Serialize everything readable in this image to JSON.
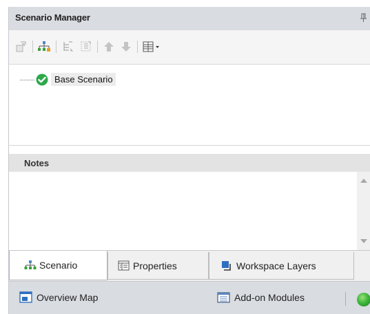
{
  "panel": {
    "title": "Scenario Manager",
    "pin_icon": "pin-icon"
  },
  "toolbar": {
    "buttons": [
      {
        "name": "new-scenario-icon",
        "enabled": false
      },
      {
        "name": "child-scenario-icon",
        "enabled": true
      },
      {
        "name": "expand-all-icon",
        "enabled": false
      },
      {
        "name": "collapse-all-icon",
        "enabled": false
      },
      {
        "name": "move-up-icon",
        "enabled": false
      },
      {
        "name": "move-down-icon",
        "enabled": false
      },
      {
        "name": "view-options-icon",
        "enabled": true
      }
    ]
  },
  "tree": {
    "items": [
      {
        "label": "Base Scenario",
        "status_icon": "check-circle-icon",
        "status_color": "#2ea84a",
        "selected": true
      }
    ]
  },
  "notes": {
    "title": "Notes",
    "value": ""
  },
  "tabs": [
    {
      "label": "Scenario",
      "icon": "hierarchy-icon",
      "active": true
    },
    {
      "label": "Properties",
      "icon": "properties-grid-icon",
      "active": false
    },
    {
      "label": "Workspace Layers",
      "icon": "layers-icon",
      "active": false
    }
  ],
  "statusbar": {
    "overview_map": {
      "label": "Overview Map",
      "icon": "map-window-icon"
    },
    "addon_modules": {
      "label": "Add-on Modules",
      "icon": "modules-icon"
    },
    "status_indicator": {
      "icon": "green-status-icon",
      "color": "#3db83a"
    }
  }
}
